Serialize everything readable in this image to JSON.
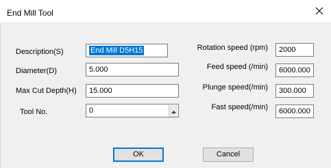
{
  "window": {
    "title": "End Mill Tool"
  },
  "left_fields": {
    "description": {
      "label": "Description(S)",
      "value": "End Mill D5H15"
    },
    "diameter": {
      "label": "Diameter(D)",
      "value": "5.000"
    },
    "max_cut_depth": {
      "label": "Max Cut Depth(H)",
      "value": "15.000"
    },
    "tool_no": {
      "label": "Tool No.",
      "value": "0"
    }
  },
  "right_fields": {
    "rotation_speed": {
      "label": "Rotation speed (rpm)",
      "value": "2000"
    },
    "feed_speed": {
      "label": "Feed speed (/min)",
      "value": "6000.000"
    },
    "plunge_speed": {
      "label": "Plunge speed(/min)",
      "value": "300.000"
    },
    "fast_speed": {
      "label": "Fast speed(/min)",
      "value": "6000.000"
    }
  },
  "buttons": {
    "ok": "OK",
    "cancel": "Cancel"
  },
  "icons": {
    "close": "close-icon",
    "spin_up": "spin-up-icon",
    "spin_down": "spin-down-icon"
  },
  "colors": {
    "selection": "#0078d7",
    "default_button_border": "#0078d7"
  }
}
